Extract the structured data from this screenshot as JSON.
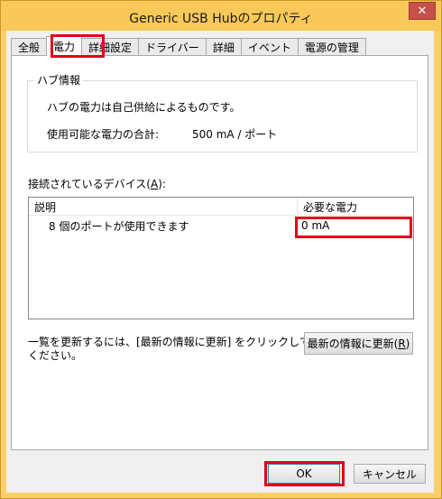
{
  "window": {
    "title": "Generic USB Hubのプロパティ",
    "close_label": "✕"
  },
  "tabs": [
    {
      "label": "全般"
    },
    {
      "label": "電力"
    },
    {
      "label": "詳細設定"
    },
    {
      "label": "ドライバー"
    },
    {
      "label": "詳細"
    },
    {
      "label": "イベント"
    },
    {
      "label": "電源の管理"
    }
  ],
  "hub_info": {
    "group_label": "ハブ情報",
    "self_powered": "ハブの電力は自己供給によるものです。",
    "total_power_label": "使用可能な電力の合計:",
    "total_power_value": "500 mA / ポート"
  },
  "devices": {
    "label_prefix": "接続されているデバイス(",
    "label_accel": "A",
    "label_suffix": "):",
    "columns": {
      "description": "説明",
      "required_power": "必要な電力"
    },
    "rows": [
      {
        "description": "8 個のポートが使用できます",
        "required_power": "0 mA"
      }
    ]
  },
  "refresh": {
    "instruction_line1": "一覧を更新するには、[最新の情報に更新] をクリックして",
    "instruction_line2": "ください。",
    "button_prefix": "最新の情報に更新(",
    "button_accel": "R",
    "button_suffix": ")"
  },
  "footer": {
    "ok_label": "OK",
    "cancel_label": "キャンセル"
  },
  "colors": {
    "highlight": "#e0001b",
    "title_bar": "#f8c958"
  }
}
